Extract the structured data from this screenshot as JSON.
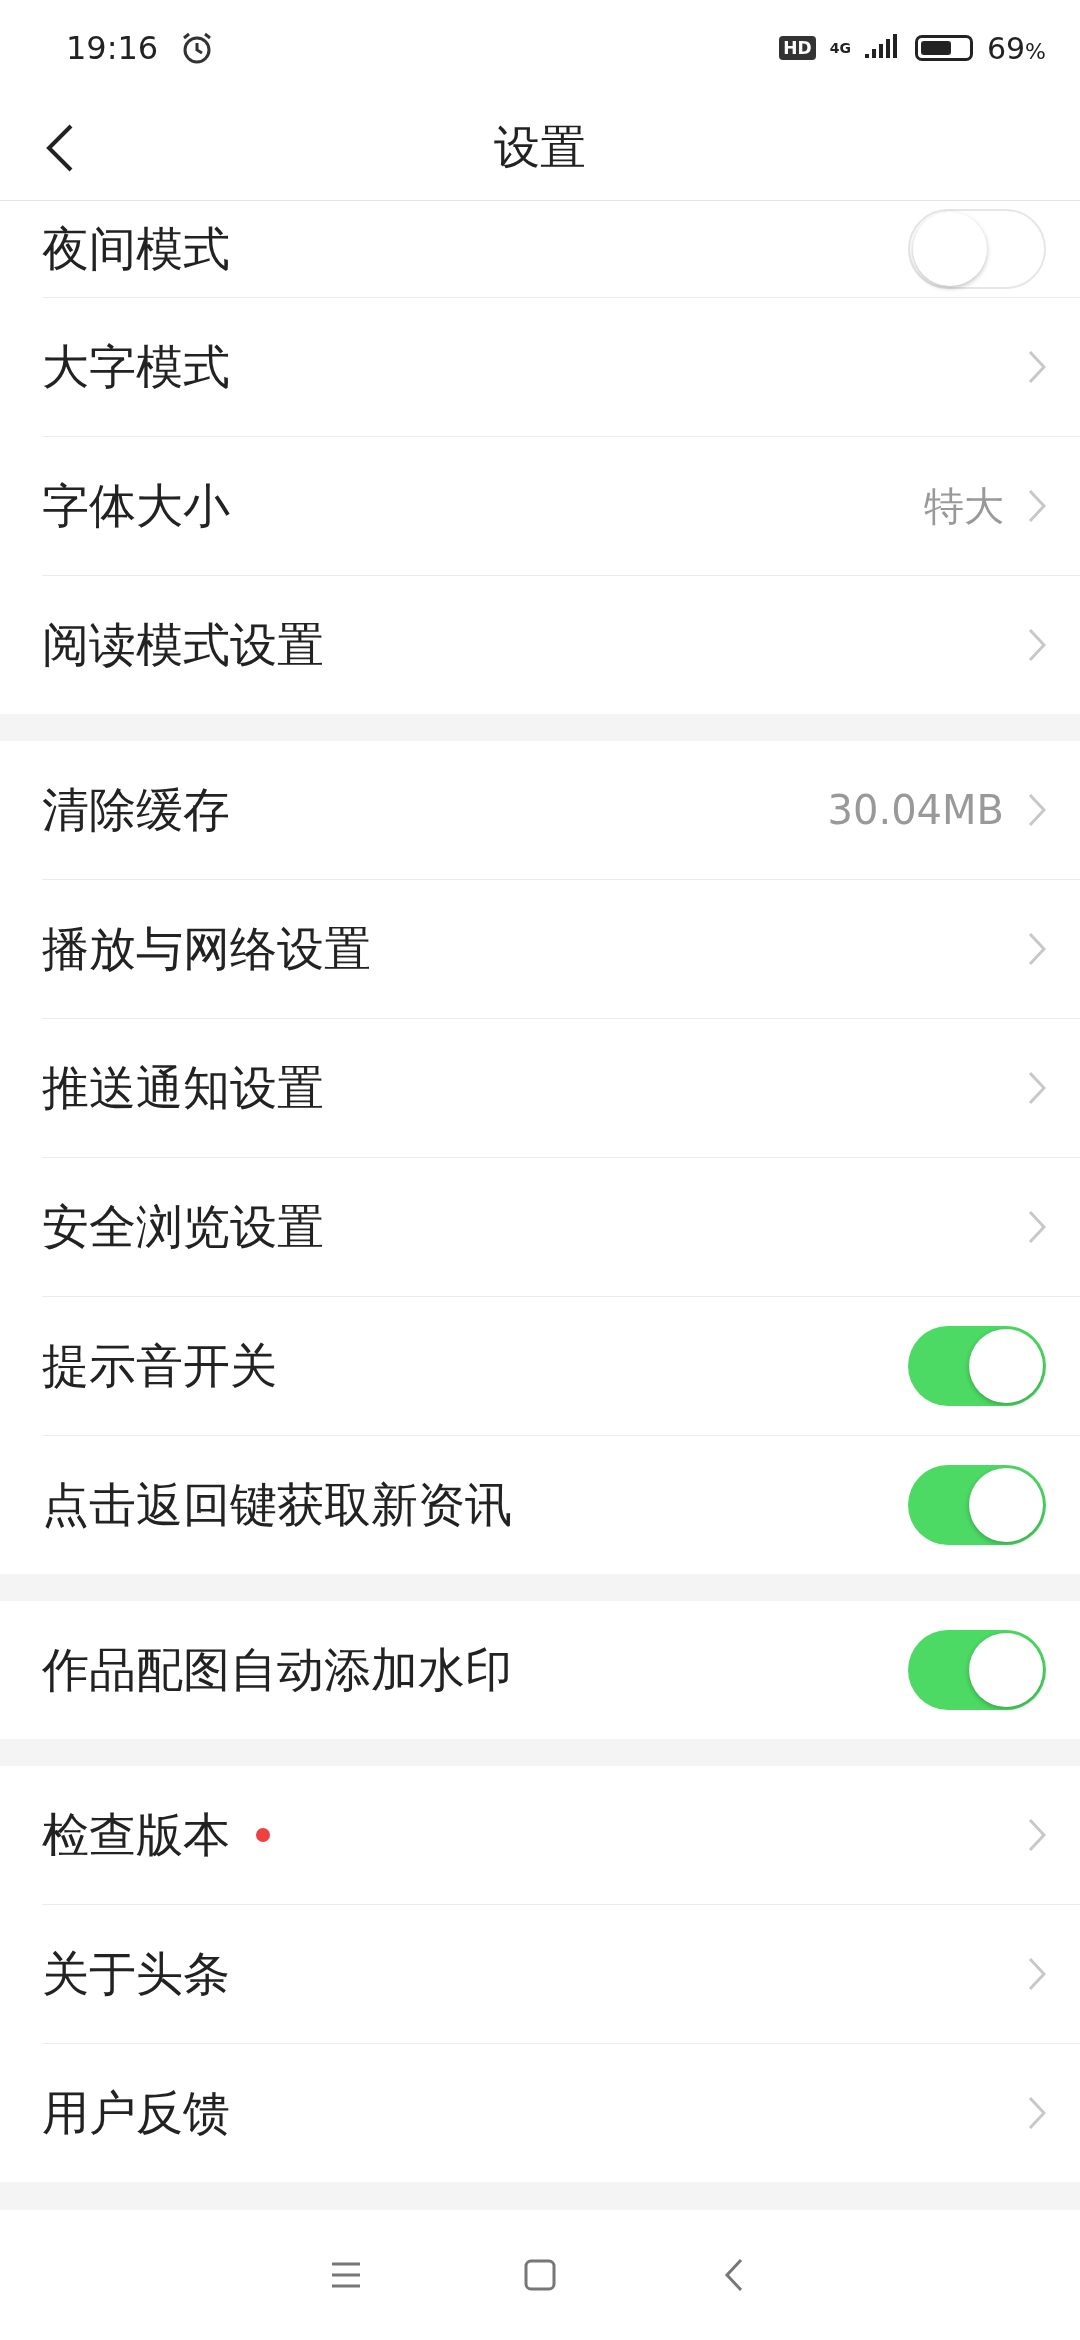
{
  "status_bar": {
    "time": "19:16",
    "hd": "HD",
    "network": "4G",
    "battery": "69",
    "battery_unit": "%"
  },
  "header": {
    "title": "设置"
  },
  "sections": [
    {
      "items": [
        {
          "kind": "toggle",
          "label": "夜间模式",
          "on": false
        },
        {
          "kind": "link",
          "label": "大字模式"
        },
        {
          "kind": "link",
          "label": "字体大小",
          "value": "特大"
        },
        {
          "kind": "link",
          "label": "阅读模式设置"
        }
      ]
    },
    {
      "items": [
        {
          "kind": "link",
          "label": "清除缓存",
          "value": "30.04MB"
        },
        {
          "kind": "link",
          "label": "播放与网络设置"
        },
        {
          "kind": "link",
          "label": "推送通知设置"
        },
        {
          "kind": "link",
          "label": "安全浏览设置"
        },
        {
          "kind": "toggle",
          "label": "提示音开关",
          "on": true
        },
        {
          "kind": "toggle",
          "label": "点击返回键获取新资讯",
          "on": true
        }
      ]
    },
    {
      "items": [
        {
          "kind": "toggle",
          "label": "作品配图自动添加水印",
          "on": true
        }
      ]
    },
    {
      "items": [
        {
          "kind": "link",
          "label": "检查版本",
          "dot": true
        },
        {
          "kind": "link",
          "label": "关于头条"
        },
        {
          "kind": "link",
          "label": "用户反馈"
        }
      ]
    }
  ]
}
